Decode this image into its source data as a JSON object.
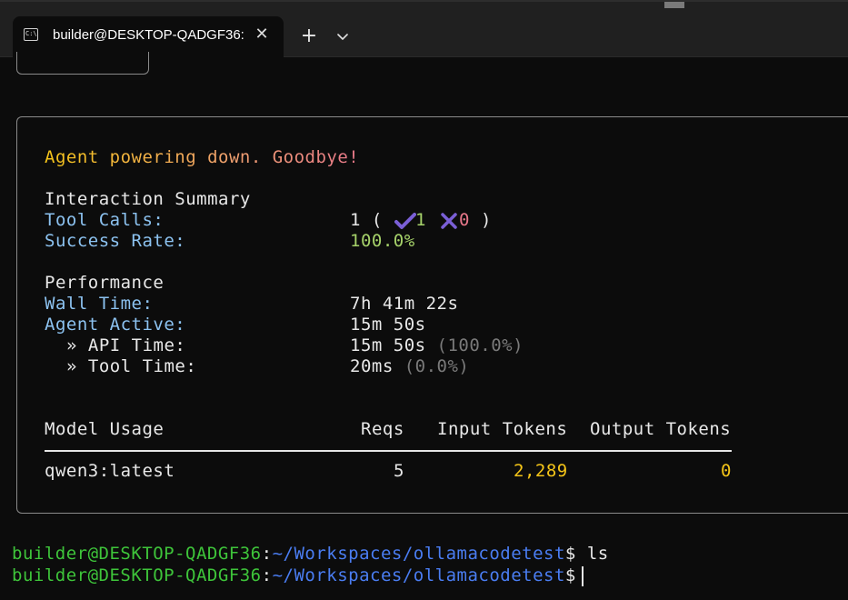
{
  "window": {
    "tab_title": "builder@DESKTOP-QADGF36:",
    "tab_icon_text": "C:\\",
    "new_tab_label": "+",
    "close_glyph": "✕"
  },
  "summary": {
    "goodbye": "Agent powering down. Goodbye!",
    "interaction_heading": "Interaction Summary",
    "tool_calls_label": "Tool Calls:",
    "tool_calls_total": "1",
    "tool_calls_open": "(",
    "tool_calls_success": "1",
    "tool_calls_fail": "0",
    "tool_calls_close": ")",
    "success_rate_label": "Success Rate:",
    "success_rate_value": "100.0%",
    "performance_heading": "Performance",
    "wall_time_label": "Wall Time:",
    "wall_time_value": "7h 41m 22s",
    "agent_active_label": "Agent Active:",
    "agent_active_value": "15m 50s",
    "api_time_label": "» API Time:",
    "api_time_value": "15m 50s",
    "api_time_pct": "(100.0%)",
    "tool_time_label": "» Tool Time:",
    "tool_time_value": "20ms",
    "tool_time_pct": "(0.0%)"
  },
  "model_usage": {
    "headers": [
      "Model Usage",
      "Reqs",
      "Input Tokens",
      "Output Tokens"
    ],
    "rows": [
      {
        "model": "qwen3:latest",
        "reqs": "5",
        "input_tokens": "2,289",
        "output_tokens": "0"
      }
    ]
  },
  "prompt": {
    "user_host": "builder@DESKTOP-QADGF36",
    "sep": ":",
    "path": "~/Workspaces/ollamacodetest",
    "symbol": "$",
    "command_1": "ls",
    "command_2": ""
  },
  "colors": {
    "background": "#0c0c0c",
    "label_cyan": "#8cc2f0",
    "success_green": "#a6d26a",
    "token_yellow": "#f5c518",
    "prompt_green": "#3ec43a",
    "prompt_blue": "#4a7df2"
  }
}
